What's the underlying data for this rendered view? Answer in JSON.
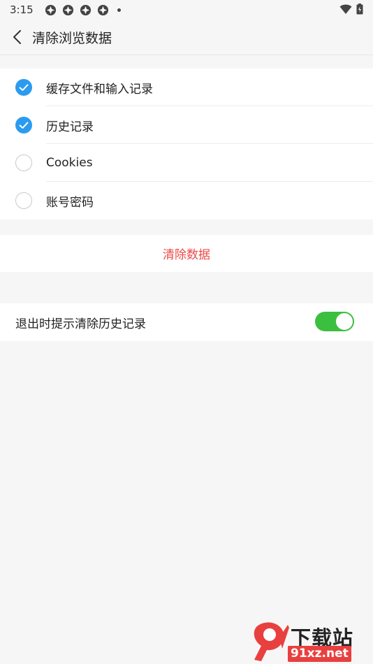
{
  "status_bar": {
    "time": "3:15",
    "notification_icons": [
      "app-icon",
      "app-icon",
      "app-icon",
      "app-icon"
    ]
  },
  "header": {
    "title": "清除浏览数据"
  },
  "options": [
    {
      "label": "缓存文件和输入记录",
      "checked": true
    },
    {
      "label": "历史记录",
      "checked": true
    },
    {
      "label": "Cookies",
      "checked": false
    },
    {
      "label": "账号密码",
      "checked": false
    }
  ],
  "clear_button": {
    "label": "清除数据"
  },
  "exit_prompt": {
    "label": "退出时提示清除历史记录",
    "enabled": true
  },
  "watermark": {
    "site_name": "下载站",
    "url": "91xz.net"
  },
  "colors": {
    "accent_blue": "#2b9bef",
    "danger_red": "#ef4a4a",
    "toggle_green": "#3bbf3f",
    "background": "#f6f6f6"
  }
}
